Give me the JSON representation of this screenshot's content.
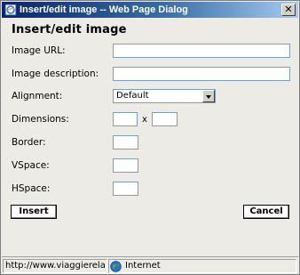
{
  "window": {
    "title": "Insert/edit image -- Web Page Dialog",
    "close_glyph": "✕"
  },
  "dialog": {
    "heading": "Insert/edit image",
    "fields": {
      "image_url": {
        "label": "Image URL:",
        "value": ""
      },
      "image_description": {
        "label": "Image description:",
        "value": ""
      },
      "alignment": {
        "label": "Alignment:",
        "value": "Default"
      },
      "dimensions": {
        "label": "Dimensions:",
        "width": "",
        "height": "",
        "separator": "x"
      },
      "border": {
        "label": "Border:",
        "value": ""
      },
      "vspace": {
        "label": "VSpace:",
        "value": ""
      },
      "hspace": {
        "label": "HSpace:",
        "value": ""
      }
    },
    "buttons": {
      "insert": "Insert",
      "cancel": "Cancel"
    }
  },
  "statusbar": {
    "url": "http://www.viaggierela",
    "zone": "Internet"
  },
  "colors": {
    "titlebar_start": "#0a246a",
    "titlebar_end": "#a6caf0",
    "dialog_bg": "#ecebe6",
    "field_border": "#7f9db9"
  },
  "icons": {
    "title": "ie-page-icon",
    "zone": "globe-icon"
  }
}
